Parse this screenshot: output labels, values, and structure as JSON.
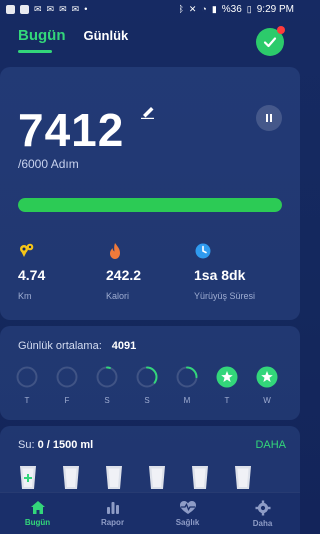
{
  "statusbar": {
    "battery": "%36",
    "time": "9:29 PM"
  },
  "tabs": {
    "today": "Bugün",
    "daily": "Günlük"
  },
  "steps": {
    "value": "7412",
    "goal_text": "/6000 Adım",
    "progress_fraction": 1.0
  },
  "stats": [
    {
      "icon": "location-pin-icon",
      "value": "4.74",
      "label": "Km",
      "color": "#f5c518"
    },
    {
      "icon": "flame-icon",
      "value": "242.2",
      "label": "Kalori",
      "color": "#f07a3a"
    },
    {
      "icon": "clock-icon",
      "value": "1sa 8dk",
      "label": "Yürüyüş Süresi",
      "color": "#2f9bf0"
    }
  ],
  "weekly": {
    "avg_label": "Günlük ortalama:",
    "avg_value": "4091",
    "days": [
      {
        "label": "T",
        "fraction": 0.0,
        "complete": false
      },
      {
        "label": "F",
        "fraction": 0.0,
        "complete": false
      },
      {
        "label": "S",
        "fraction": 0.05,
        "complete": false
      },
      {
        "label": "S",
        "fraction": 0.35,
        "complete": false
      },
      {
        "label": "M",
        "fraction": 0.25,
        "complete": false
      },
      {
        "label": "T",
        "fraction": 1.0,
        "complete": true
      },
      {
        "label": "W",
        "fraction": 1.0,
        "complete": true
      }
    ]
  },
  "water": {
    "label": "Su:",
    "amount": "0 / 1500 ml",
    "more": "DAHA",
    "glass_count": 6
  },
  "nav": [
    {
      "label": "Bugün",
      "icon": "home-icon",
      "active": true
    },
    {
      "label": "Rapor",
      "icon": "bar-chart-icon",
      "active": false
    },
    {
      "label": "Sağlık",
      "icon": "heart-pulse-icon",
      "active": false
    },
    {
      "label": "Daha",
      "icon": "gear-icon",
      "active": false
    }
  ],
  "colors": {
    "accent": "#33d67a",
    "background": "#162a63",
    "progress": "#2ccb55",
    "badge": "#ff3b3b"
  }
}
